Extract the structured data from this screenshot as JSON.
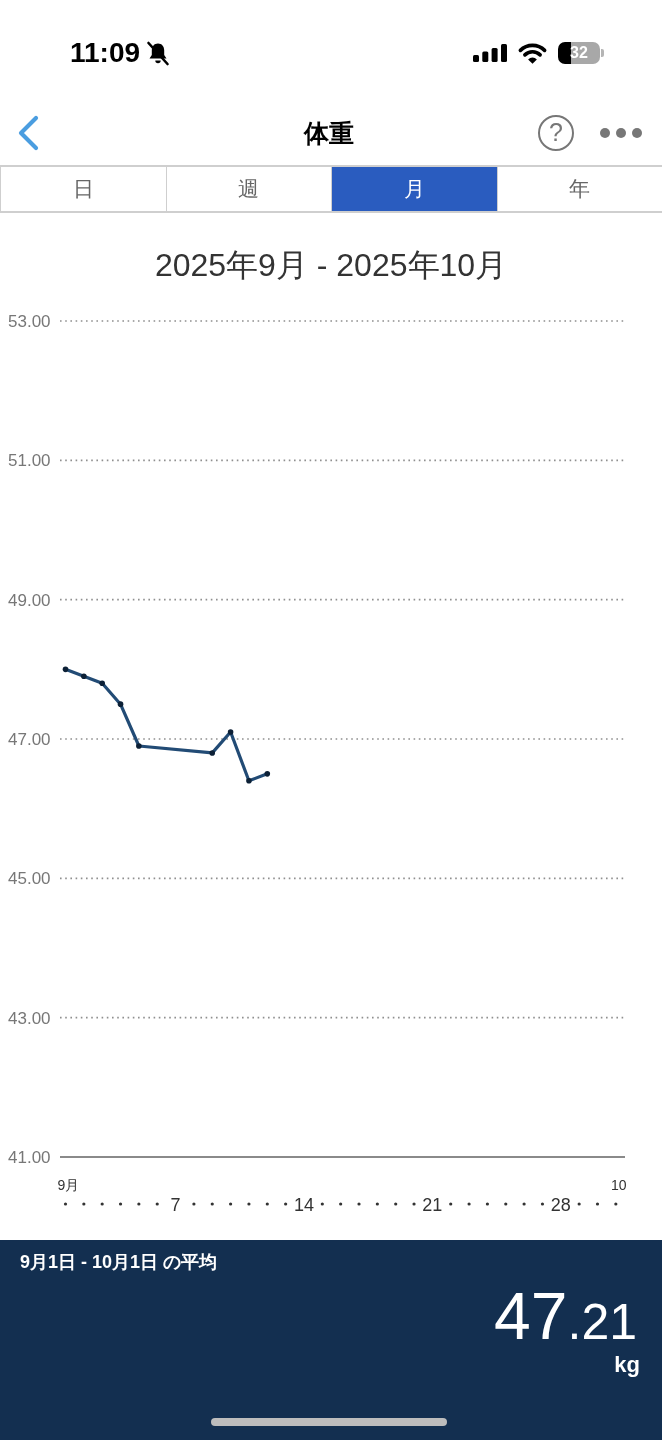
{
  "status_bar": {
    "time": "11:09",
    "battery": "32"
  },
  "nav_bar": {
    "title": "体重",
    "help": "?"
  },
  "tabs": [
    {
      "label": "日",
      "selected": false
    },
    {
      "label": "週",
      "selected": false
    },
    {
      "label": "月",
      "selected": true
    },
    {
      "label": "年",
      "selected": false
    }
  ],
  "chart": {
    "chart_data": {
      "type": "line",
      "title": "2025年9月 - 2025年10月",
      "x": [
        1,
        2,
        3,
        4,
        5,
        9,
        10,
        11,
        12
      ],
      "values": [
        48.0,
        47.9,
        47.8,
        47.5,
        46.9,
        46.8,
        47.1,
        46.4,
        46.5
      ],
      "xlim": [
        0.7,
        31.5
      ],
      "ylim": [
        41,
        53
      ],
      "xticks": [
        {
          "value": 7,
          "label": "7"
        },
        {
          "value": 14,
          "label": "14"
        },
        {
          "value": 21,
          "label": "21"
        },
        {
          "value": 28,
          "label": "28"
        }
      ],
      "yticks": [
        {
          "value": 53,
          "label": "53.00"
        },
        {
          "value": 51,
          "label": "51.00"
        },
        {
          "value": 49,
          "label": "49.00"
        },
        {
          "value": 47,
          "label": "47.00"
        },
        {
          "value": 45,
          "label": "45.00"
        },
        {
          "value": 43,
          "label": "43.00"
        },
        {
          "value": 41,
          "label": "41.00"
        }
      ],
      "grid": true,
      "annotations": [
        "9月",
        "10"
      ]
    }
  },
  "average": {
    "label": "9月1日 - 10月1日 の平均",
    "value": "47.21",
    "unit": "kg"
  }
}
